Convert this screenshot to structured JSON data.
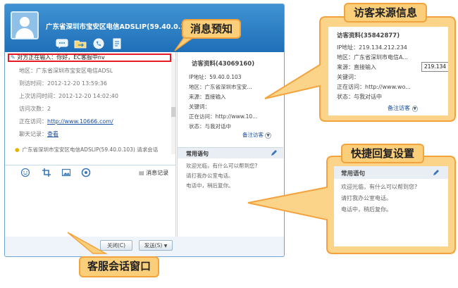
{
  "window": {
    "title": "广东省深圳市宝安区电信ADSLIP(59.40.0.103)"
  },
  "typing_status": "对方正在输入：你好，EC客服中nv",
  "visitor_info": {
    "region": "地区：广东省深圳市宝安区电信ADSL",
    "arrival_time": "到访时间：2012-12-20 13:59:36",
    "last_visit_time": "上次访问时间：2012-12-20 14:02:40",
    "visit_count": "访问次数：2",
    "visiting_label": "正在访问：",
    "visiting_url": "http://www.10666.com/",
    "chat_record_label": "聊天记录：",
    "chat_record_link": "查看",
    "invite_text": "广东省深圳市宝安区电信ADSLIP(59.40.0.103) 请求会话"
  },
  "toolbar": {
    "message_record": "消息记录"
  },
  "buttons": {
    "close": "关闭(C)",
    "send": "发送(S)"
  },
  "right_pane": {
    "title": "访客资料(43069160)",
    "ip": "IP地址：59.40.0.103",
    "region": "地区：广东省深圳市宝安...",
    "source": "来源：直接输入",
    "keyword": "关键词：",
    "visiting": "正在访问：http://www.10...",
    "status": "状态：与我对话中",
    "remark_link": "备注访客"
  },
  "quick_reply": {
    "title": "常用语句",
    "items": [
      "欢迎光临，有什么可以帮到您?",
      "请打我办公室电话。",
      "电话中，稍后复你。"
    ]
  },
  "callouts": {
    "notice": "消息预知",
    "visitor_source": "访客来源信息",
    "quick_reply_settings": "快捷回复设置",
    "chat_window": "客服会话窗口"
  },
  "zoom_visitor": {
    "title": "访客资料(35842877)",
    "ip": "IP地址：219.134.212.234",
    "region": "地区：广东省深圳市电信A...",
    "source": "来源：直接输入",
    "keyword": "关键词：",
    "visiting": "正在访问：http://www.wo...",
    "status": "状态：与我对话中",
    "remark_link": "备注访客",
    "tooltip": "219.134"
  },
  "zoom_quick_reply": {
    "title": "常用语句",
    "items": [
      "欢迎光临，有什么可以帮到您?",
      "请打我办公室电话。",
      "电话中，稍后复你。"
    ]
  },
  "colors": {
    "header_blue": "#2a7fc6",
    "callout_fill": "#fbcf7a",
    "callout_border": "#f3a33d",
    "highlight_red": "#e51c23",
    "link_blue": "#1a4fa0"
  }
}
